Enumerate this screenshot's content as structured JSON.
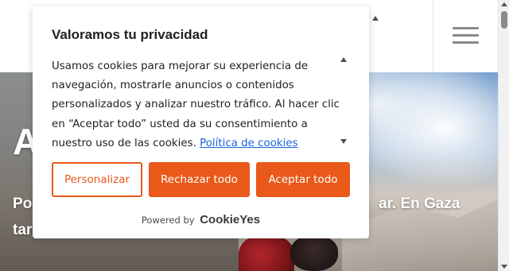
{
  "colors": {
    "accent": "#e8591a",
    "link": "#1863dc",
    "text": "#212121"
  },
  "header": {
    "menu_icon": "hamburger-menu-icon"
  },
  "hero": {
    "title_fragment": "A",
    "line1_left": "Po",
    "line1_right": "ar. En Gaza",
    "line2_left": "tar"
  },
  "consent": {
    "title": "Valoramos tu privacidad",
    "body_text": "Usamos cookies para mejorar su experiencia de navegación, mostrarle anuncios o contenidos personalizados y analizar nuestro tráfico. Al hacer clic en “Aceptar todo” usted da su consentimiento a nuestro uso de las cookies.",
    "policy_link": "Política de cookies",
    "buttons": {
      "customize": "Personalizar",
      "reject": "Rechazar todo",
      "accept": "Aceptar todo"
    },
    "powered_by": "Powered by",
    "brand": "CookieYes"
  }
}
